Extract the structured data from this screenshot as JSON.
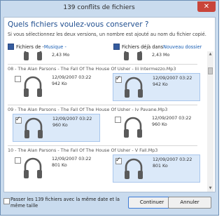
{
  "window": {
    "title": "139 conflits de fichiers",
    "close_glyph": "✕"
  },
  "dialog": {
    "heading": "Quels fichiers voulez-vous conserver ?",
    "subtext": "Si vous sélectionnez les deux versions, un nombre est ajouté au nom du fichier copié."
  },
  "columns": {
    "left_prefix": "Fichiers de - ",
    "left_link": "Musique -",
    "right_prefix": "Fichiers déjà dans ",
    "right_link": "Nouveau dossier"
  },
  "top_partial": {
    "left_size": "2,43 Mo",
    "right_size": "2,43 Mo"
  },
  "groups": [
    {
      "title": "08 - The Alan Parsons - The Fall Of The House Of Usher - Iii Intermezzo.Mp3",
      "left": {
        "date": "12/09/2007 03:22",
        "size": "942 Ko",
        "checked": false
      },
      "right": {
        "date": "12/09/2007 03:22",
        "size": "942 Ko",
        "checked": true
      }
    },
    {
      "title": "09 - The Alan Parsons - The Fall Of The House Of Usher - Iv Pavane.Mp3",
      "left": {
        "date": "12/09/2007 03:22",
        "size": "960 Ko",
        "checked": true
      },
      "right": {
        "date": "12/09/2007 03:22",
        "size": "960 Ko",
        "checked": false
      }
    },
    {
      "title": "10 - The Alan Parsons - The Fall Of The House Of Usher - V Fall.Mp3",
      "left": {
        "date": "12/09/2007 03:22",
        "size": "801 Ko",
        "checked": false
      },
      "right": {
        "date": "12/09/2007 03:22",
        "size": "801 Ko",
        "checked": true
      }
    }
  ],
  "footer": {
    "skip_label": "Passer les 139 fichiers avec la même date et la même taille",
    "continue_label": "Continuer",
    "cancel_label": "Annuler"
  },
  "icons": {
    "file_icon": "headphones-icon"
  },
  "colors": {
    "accent": "#1f4e8f",
    "link": "#1a5fb4",
    "selection": "#dbe9f9",
    "title_bar": "#c9dbee"
  }
}
